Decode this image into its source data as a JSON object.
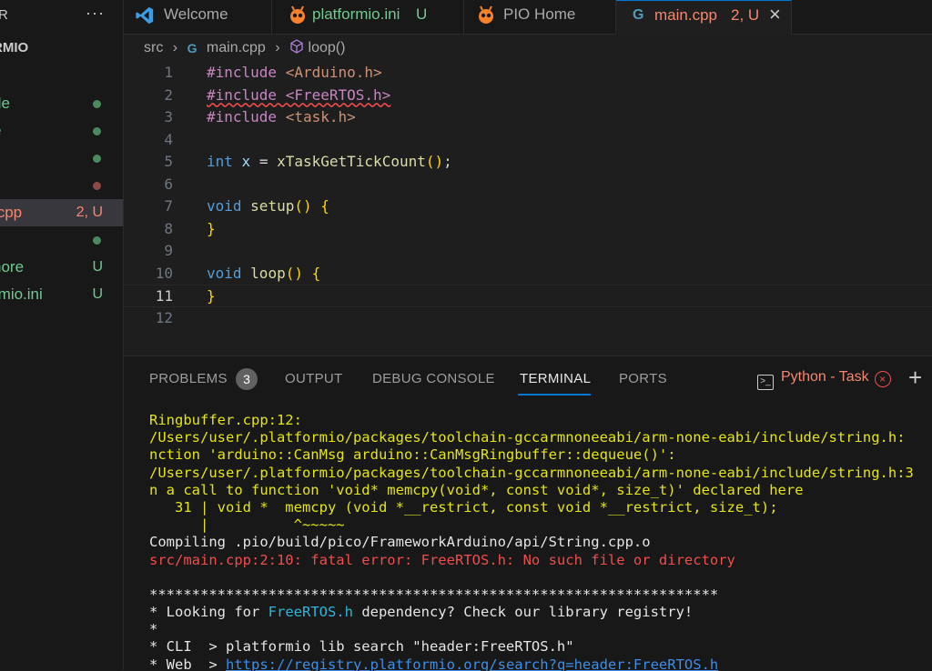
{
  "sidebar": {
    "title": "R",
    "more": "···",
    "section": "RMIO",
    "items": [
      {
        "label": "de",
        "badge": ""
      },
      {
        "label": "e",
        "badge": ""
      },
      {
        "label": "",
        "badge": ""
      },
      {
        "label": "",
        "badge": ""
      },
      {
        "label": ".cpp",
        "badge": "2, U"
      },
      {
        "label": "",
        "badge": ""
      },
      {
        "label": "nore",
        "badge": "U"
      },
      {
        "label": "rmio.ini",
        "badge": "U"
      }
    ]
  },
  "tabs": [
    {
      "label": "Welcome",
      "badge": ""
    },
    {
      "label": "platformio.ini",
      "badge": "U"
    },
    {
      "label": "PIO Home",
      "badge": ""
    },
    {
      "label": "main.cpp",
      "badge": "2, U",
      "close": "×"
    }
  ],
  "breadcrumb": {
    "folder": "src",
    "file": "main.cpp",
    "symbol": "loop()",
    "sep": "›"
  },
  "editor": {
    "line_numbers": [
      "1",
      "2",
      "3",
      "4",
      "5",
      "6",
      "7",
      "8",
      "9",
      "10",
      "11",
      "12"
    ],
    "lines": [
      [
        "#include ",
        "<Arduino.h>"
      ],
      [
        "#include <FreeRTOS.h>"
      ],
      [
        "#include ",
        "<task.h>"
      ],
      [],
      [
        "int",
        " ",
        "x",
        " = ",
        "xTaskGetTickCount",
        "()",
        ";"
      ],
      [],
      [
        "void",
        " ",
        "setup",
        "()",
        " ",
        "{"
      ],
      [
        "}"
      ],
      [],
      [
        "void",
        " ",
        "loop",
        "()",
        " ",
        "{"
      ],
      [
        "}"
      ],
      []
    ]
  },
  "panel": {
    "tabs": [
      "PROBLEMS",
      "OUTPUT",
      "DEBUG CONSOLE",
      "TERMINAL",
      "PORTS"
    ],
    "problems_count": "3",
    "terminal_name": "Python - Task",
    "kill": "×",
    "add": "+"
  },
  "terminal": {
    "lines": [
      "Ringbuffer.cpp:12:",
      "/Users/user/.platformio/packages/toolchain-gccarmnoneeabi/arm-none-eabi/include/string.h:",
      "nction 'arduino::CanMsg arduino::CanMsgRingbuffer::dequeue()':",
      "/Users/user/.platformio/packages/toolchain-gccarmnoneeabi/arm-none-eabi/include/string.h:3",
      "n a call to function 'void* memcpy(void*, const void*, size_t)' declared here",
      "   31 | void *  memcpy (void *__restrict, const void *__restrict, size_t);",
      "      |          ^~~~~~",
      "Compiling .pio/build/pico/FrameworkArduino/api/String.cpp.o",
      "src/main.cpp:2:10: fatal error: FreeRTOS.h: No such file or directory",
      "",
      "*******************************************************************",
      "* Looking for ",
      "*",
      "* CLI  > platformio lib search \"header:FreeRTOS.h\"",
      "* Web  > "
    ],
    "dep_name": "FreeRTOS.h",
    "dep_suffix": " dependency? Check our library registry!",
    "url": "https://registry.platformio.org/search?q=header:FreeRTOS.h"
  },
  "colors": {
    "accent": "#0078d4",
    "untracked": "#73c991",
    "error": "#f14c4c",
    "warning_text": "#e5e510"
  }
}
